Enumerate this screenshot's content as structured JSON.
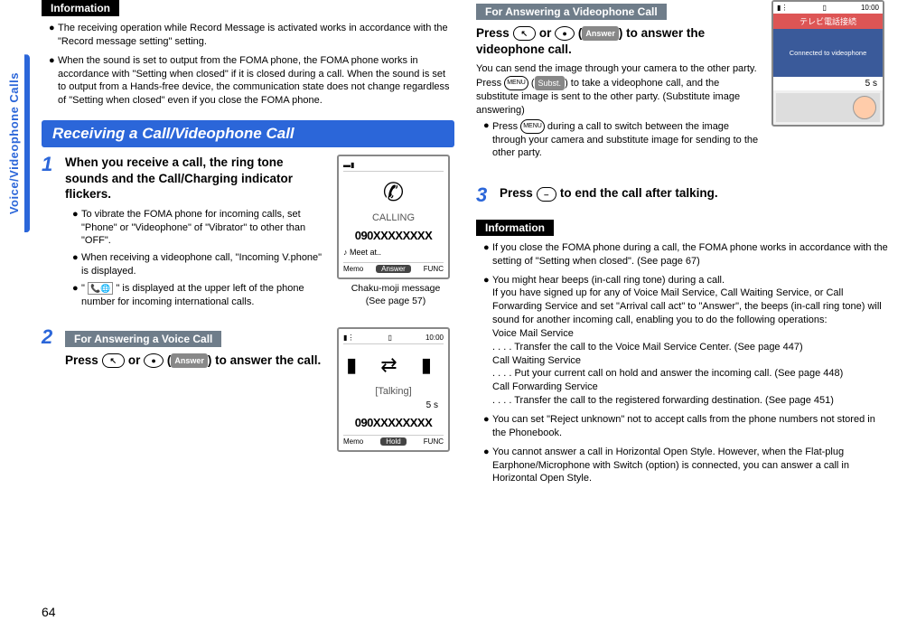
{
  "sideTab": "Voice/Videophone Calls",
  "pageNumber": "64",
  "leftCol": {
    "infoLabel": "Information",
    "infoBullets": [
      "The receiving operation while Record Message is activated works in accordance with the \"Record message setting\" setting.",
      "When the sound is set to output from the FOMA phone, the FOMA phone works in accordance with \"Setting when closed\" if it is closed during a call. When the sound is set to output from a Hands-free device, the communication state does not change regardless of \"Setting when closed\" even if you close the FOMA phone."
    ],
    "sectionTitle": "Receiving a Call/Videophone Call",
    "step1": {
      "num": "1",
      "title": "When you receive a call, the ring tone sounds and the Call/Charging indicator flickers.",
      "bullets1": "To vibrate the FOMA phone for incoming calls, set \"Phone\" or \"Videophone\" of \"Vibrator\" to other than \"OFF\".",
      "bullets2": "When receiving a videophone call, \"Incoming V.phone\" is displayed.",
      "bullets3a": "\"",
      "bullets3b": "\" is displayed at the upper left of the phone number for incoming international calls.",
      "captionLine1": "Chaku-moji message",
      "captionLine2": "(See page 57)"
    },
    "step2": {
      "num": "2",
      "subLabel": "For Answering a Voice Call",
      "pressA": "Press ",
      "pressB": " or ",
      "pressC": "(",
      "pressD": ") to answer the call.",
      "answerBtn": "Answer"
    },
    "screen1": {
      "antenna": "▬▮",
      "calling": "CALLING",
      "number": "090XXXXXXXX",
      "meet": "♪ Meet at..",
      "skL": "Memo",
      "skC": "Answer",
      "skR": "FUNC"
    },
    "screen2": {
      "antenna": "▮⋮",
      "batt": "▯",
      "time": "10:00",
      "talking": "[Talking]",
      "dur": "5 s",
      "number": "090XXXXXXXX",
      "skL": "Memo",
      "skC": "Hold",
      "skR": "FUNC"
    }
  },
  "rightCol": {
    "subLabel": "For Answering a Videophone Call",
    "line1a": "Press ",
    "line1b": " or ",
    "line1c": "(",
    "line1d": ") to answer the videophone call.",
    "answerBtn": "Answer",
    "para1a": "You can send the image through your camera to the other party. Press ",
    "menuKey": "MENU",
    "substBtn": "Subst.",
    "para1b": "(",
    "para1c": ") to take a videophone call, and the substitute image is sent to the other party. (Substitute image answering)",
    "bullet1a": "Press ",
    "bullet1b": " during a call to switch between the image through your camera and substitute image for sending to the other party.",
    "vpScreen": {
      "antenna": "▮⋮",
      "icon": "▯",
      "time": "10:00",
      "title": "テレビ電話接続",
      "connected": "Connected to videophone",
      "dur": "5 s"
    },
    "step3": {
      "num": "3",
      "textA": "Press ",
      "textB": " to end the call after talking."
    },
    "infoLabel": "Information",
    "info": {
      "b1": "If you close the FOMA phone during a call, the FOMA phone works in accordance with the setting of \"Setting when closed\". (See page 67)",
      "b2a": "You might hear beeps (in-call ring tone) during a call.",
      "b2b": "If you have signed up for any of Voice Mail Service, Call Waiting Service, or Call Forwarding Service and set \"Arrival call act\" to \"Answer\", the beeps (in-call ring tone) will sound for another incoming call, enabling you to do the following operations:",
      "vms": "Voice Mail Service",
      "vmsDots": ". . . . Transfer the call to the Voice Mail Service Center. (See page 447)",
      "cws": "Call Waiting Service",
      "cwsDots": ". . . . Put your current call on hold and answer the incoming call. (See page 448)",
      "cfs": "Call Forwarding Service",
      "cfsDots": ". . . . Transfer the call to the registered forwarding destination. (See page 451)",
      "b3": "You can set \"Reject unknown\" not to accept calls from the phone numbers not stored in the Phonebook.",
      "b4": "You cannot answer a call in Horizontal Open Style. However, when the Flat-plug Earphone/Microphone with Switch (option) is connected, you can answer a call in Horizontal Open Style."
    }
  }
}
